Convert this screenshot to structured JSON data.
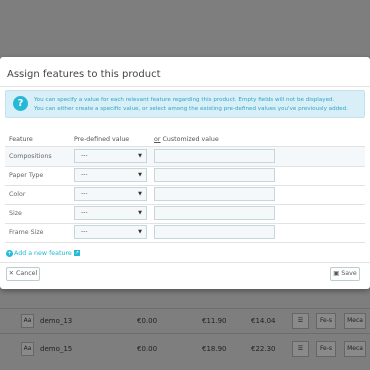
{
  "background": {
    "rows": [
      {
        "aa": "Aa",
        "name": "demo_13",
        "price1": "€0.00",
        "price2": "€11.90",
        "price3": "€14.04",
        "btn1": "Fe-s",
        "btn2": "Meca"
      },
      {
        "aa": "Aa",
        "name": "demo_15",
        "price1": "€0.00",
        "price2": "€18.90",
        "price3": "€22.30",
        "btn1": "Fe-s",
        "btn2": "Meca"
      }
    ]
  },
  "modal": {
    "title": "Assign features to this product",
    "info_line1": "You can specify a value for each relevant feature regarding this product. Empty fields will not be displayed.",
    "info_line2": "You can either create a specific value, or select among the existing pre-defined values you've previously added.",
    "headers": {
      "feature": "Feature",
      "predefined": "Pre-defined value",
      "or": "or",
      "custom": " Customized value"
    },
    "features": [
      {
        "label": "Compositions",
        "selected": "---",
        "custom": ""
      },
      {
        "label": "Paper Type",
        "selected": "---",
        "custom": ""
      },
      {
        "label": "Color",
        "selected": "---",
        "custom": ""
      },
      {
        "label": "Size",
        "selected": "---",
        "custom": ""
      },
      {
        "label": "Frame Size",
        "selected": "---",
        "custom": ""
      }
    ],
    "add_feature": "Add a new feature",
    "cancel": "Cancel",
    "save": "Save"
  },
  "colors": {
    "accent": "#25b9d7",
    "info_bg": "#d8eff7",
    "overlay": "#7e7e7e"
  },
  "icons": {
    "info": "info-icon",
    "plus": "plus-circle-icon",
    "external": "external-link-icon",
    "close": "close-icon",
    "save": "floppy-disk-icon",
    "list": "list-icon"
  }
}
